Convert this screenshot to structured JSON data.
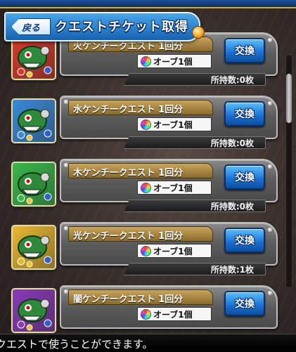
{
  "header": {
    "back_label": "戻る",
    "title": "クエストチケット取得"
  },
  "currency_icon": "rainbow-orb-icon",
  "tickets": [
    {
      "name": "火ケンチークエスト 1回分",
      "cost": "オーブ1個",
      "owned": "所持数:0枚",
      "exchange_label": "交換",
      "element": "fire",
      "accent": "#d83a2a"
    },
    {
      "name": "水ケンチークエスト 1回分",
      "cost": "オーブ1個",
      "owned": "所持数:0枚",
      "exchange_label": "交換",
      "element": "water",
      "accent": "#3a8ad8"
    },
    {
      "name": "木ケンチークエスト 1回分",
      "cost": "オーブ1個",
      "owned": "所持数:0枚",
      "exchange_label": "交換",
      "element": "wood",
      "accent": "#3ab84a"
    },
    {
      "name": "光ケンチークエスト 1回分",
      "cost": "オーブ1個",
      "owned": "所持数:1枚",
      "exchange_label": "交換",
      "element": "light",
      "accent": "#e8b830"
    },
    {
      "name": "闇ケンチークエスト 1回分",
      "cost": "オーブ1個",
      "owned": "",
      "exchange_label": "交換",
      "element": "dark",
      "accent": "#8a3ab8"
    }
  ],
  "scroll_position": 0.1,
  "footer_text": "クエストで使うことができます。"
}
